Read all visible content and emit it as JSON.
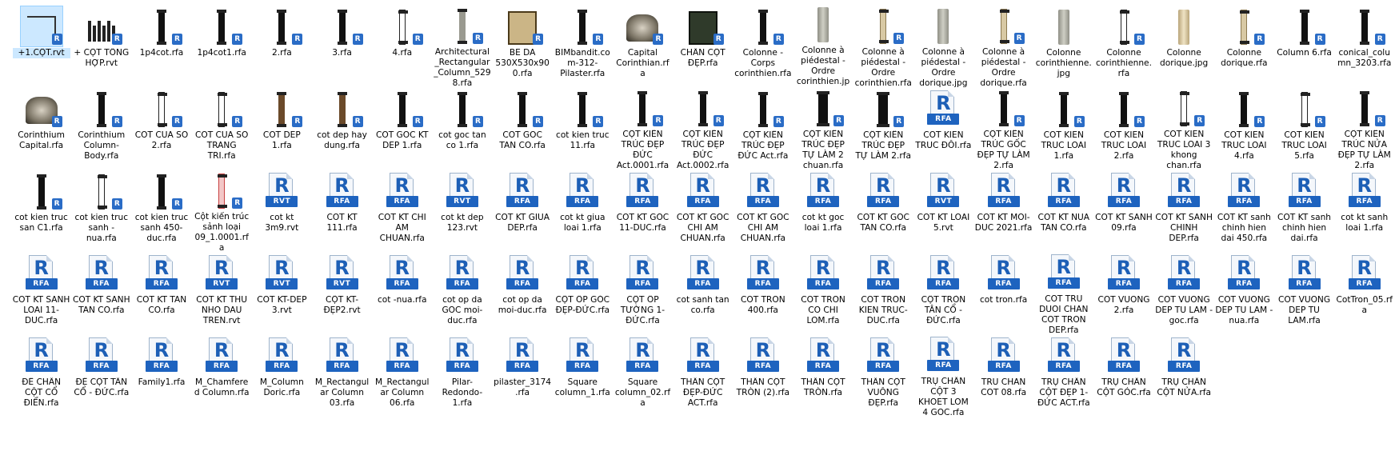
{
  "window": {
    "view": "large-icons"
  },
  "badge_letter": "R",
  "colors": {
    "accent": "#1e63bf",
    "selection": "#cce8ff"
  },
  "items": [
    {
      "name": "+1.CỘT.rvt",
      "type": "sketch",
      "selected": true
    },
    {
      "name": "+ CỘT TỔNG HỢP.rvt",
      "type": "multi"
    },
    {
      "name": "1p4cot.rfa",
      "type": "col"
    },
    {
      "name": "1p4cot1.rfa",
      "type": "col"
    },
    {
      "name": "2.rfa",
      "type": "col"
    },
    {
      "name": "3.rfa",
      "type": "col"
    },
    {
      "name": "4.rfa",
      "type": "col-white"
    },
    {
      "name": "Architectural_Rectangular_Column_5298.rfa",
      "type": "col-gray"
    },
    {
      "name": "BE DA 530X530x900.rfa",
      "type": "box"
    },
    {
      "name": "BIMbandit.com-312-Pilaster.rfa",
      "type": "col"
    },
    {
      "name": "Capital Corinthian.rfa",
      "type": "capital"
    },
    {
      "name": "CHÂN CỘT ĐẸP.rfa",
      "type": "box-dark"
    },
    {
      "name": "Colonne - Corps corinthien.rfa",
      "type": "col"
    },
    {
      "name": "Colonne à piédestal - Ordre corinthien.jpg",
      "type": "photo"
    },
    {
      "name": "Colonne à piédestal - Ordre corinthien.rfa",
      "type": "col-tan"
    },
    {
      "name": "Colonne à piédestal - Ordre dorique.jpg",
      "type": "photo"
    },
    {
      "name": "Colonne à piédestal - Ordre dorique.rfa",
      "type": "col-tan"
    },
    {
      "name": "Colonne corinthienne.jpg",
      "type": "photo"
    },
    {
      "name": "Colonne corinthienne.rfa",
      "type": "col-white"
    },
    {
      "name": "Colonne dorique.jpg",
      "type": "photo-tan"
    },
    {
      "name": "Colonne dorique.rfa",
      "type": "col-tan"
    },
    {
      "name": "Column 6.rfa",
      "type": "col"
    },
    {
      "name": "conical_column_3203.rfa",
      "type": "col"
    },
    {
      "name": "Corinthium Capital.rfa",
      "type": "capital"
    },
    {
      "name": "Corinthium Column-Body.rfa",
      "type": "col"
    },
    {
      "name": "COT CUA SO 2.rfa",
      "type": "col-white"
    },
    {
      "name": "COT CUA SO TRANG TRI.rfa",
      "type": "col-white"
    },
    {
      "name": "COT DEP 1.rfa",
      "type": "col-brown"
    },
    {
      "name": "cot dep hay dung.rfa",
      "type": "col-brown"
    },
    {
      "name": "COT GOC KT DEP 1.rfa",
      "type": "col"
    },
    {
      "name": "cot goc tan co 1.rfa",
      "type": "col"
    },
    {
      "name": "COT GOC TAN CO.rfa",
      "type": "col"
    },
    {
      "name": "cot kien truc 11.rfa",
      "type": "col"
    },
    {
      "name": "CỘT KIẾN TRÚC ĐẸP ĐỨC Act.0001.rfa",
      "type": "col"
    },
    {
      "name": "CỘT KIẾN TRÚC ĐẸP ĐỨC Act.0002.rfa",
      "type": "col"
    },
    {
      "name": "CỘT KIẾN TRÚC ĐẸP ĐỨC Act.rfa",
      "type": "col"
    },
    {
      "name": "CỘT KIẾN TRÚC ĐẸP TỰ LÀM 2 chuan.rfa",
      "type": "col-wide"
    },
    {
      "name": "CỘT KIẾN TRÚC ĐẸP TỰ LÀM 2.rfa",
      "type": "col-wide"
    },
    {
      "name": "COT KIEN TRUC ĐÔI.rfa",
      "type": "doc",
      "ext": "RFA"
    },
    {
      "name": "CỘT KIẾN TRÚC GỐC ĐẸP TỰ LÀM 2.rfa",
      "type": "col"
    },
    {
      "name": "COT KIEN TRUC LOAI 1.rfa",
      "type": "col"
    },
    {
      "name": "COT KIEN TRUC LOAI 2.rfa",
      "type": "col"
    },
    {
      "name": "COT KIEN TRUC LOAI 3 khong chan.rfa",
      "type": "col-white"
    },
    {
      "name": "COT KIEN TRUC LOAI 4.rfa",
      "type": "col"
    },
    {
      "name": "COT KIEN TRUC LOAI 5.rfa",
      "type": "col-white"
    },
    {
      "name": "CỘT KIẾN TRÚC NỬA ĐẸP TỰ LÀM 2.rfa",
      "type": "col"
    },
    {
      "name": "cot kien truc san C1.rfa",
      "type": "col"
    },
    {
      "name": "cot kien truc sanh - nua.rfa",
      "type": "col-white"
    },
    {
      "name": "cot kien truc sanh 450-duc.rfa",
      "type": "col"
    },
    {
      "name": "Cột kiến trúc sảnh loại 09_1.0001.rfa",
      "type": "col-red"
    },
    {
      "name": "cot kt 3m9.rvt",
      "type": "doc",
      "ext": "RVT"
    },
    {
      "name": "COT KT 111.rfa",
      "type": "doc",
      "ext": "RFA"
    },
    {
      "name": "COT KT CHI AM CHUAN.rfa",
      "type": "doc",
      "ext": "RFA"
    },
    {
      "name": "cot kt dep 123.rvt",
      "type": "doc",
      "ext": "RVT"
    },
    {
      "name": "COT KT GIUA DEP.rfa",
      "type": "doc",
      "ext": "RFA"
    },
    {
      "name": "cot kt giua loai 1.rfa",
      "type": "doc",
      "ext": "RFA"
    },
    {
      "name": "COT KT GOC 11-DUC.rfa",
      "type": "doc",
      "ext": "RFA"
    },
    {
      "name": "COT KT GOC CHI AM CHUAN.rfa",
      "type": "doc",
      "ext": "RFA"
    },
    {
      "name": "COT KT GOC CHI AM CHUAN.rfa",
      "type": "doc",
      "ext": "RFA"
    },
    {
      "name": "cot kt goc loai 1.rfa",
      "type": "doc",
      "ext": "RFA"
    },
    {
      "name": "COT KT GOC TAN CO.rfa",
      "type": "doc",
      "ext": "RFA"
    },
    {
      "name": "COT KT LOAI 5.rvt",
      "type": "doc",
      "ext": "RVT"
    },
    {
      "name": "COT KT MOI-DUC 2021.rfa",
      "type": "doc",
      "ext": "RFA"
    },
    {
      "name": "COT KT NUA TAN CO.rfa",
      "type": "doc",
      "ext": "RFA"
    },
    {
      "name": "COT KT SANH 09.rfa",
      "type": "doc",
      "ext": "RFA"
    },
    {
      "name": "COT KT SANH CHINH DEP.rfa",
      "type": "doc",
      "ext": "RFA"
    },
    {
      "name": "COT KT sanh chinh hien dai 450.rfa",
      "type": "doc",
      "ext": "RFA"
    },
    {
      "name": "COT KT sanh chinh hien dai.rfa",
      "type": "doc",
      "ext": "RFA"
    },
    {
      "name": "cot kt sanh loai 1.rfa",
      "type": "doc",
      "ext": "RFA"
    },
    {
      "name": "COT KT SANH LOAI 11-DUC.rfa",
      "type": "doc",
      "ext": "RFA"
    },
    {
      "name": "COT KT SANH TAN CO.rfa",
      "type": "doc",
      "ext": "RFA"
    },
    {
      "name": "COT KT TAN CO.rfa",
      "type": "doc",
      "ext": "RFA"
    },
    {
      "name": "COT KT THU NHO DAU TREN.rvt",
      "type": "doc",
      "ext": "RVT"
    },
    {
      "name": "COT KT-DEP 3.rvt",
      "type": "doc",
      "ext": "RVT"
    },
    {
      "name": "CỘT KT-ĐẸP2.rvt",
      "type": "doc",
      "ext": "RVT"
    },
    {
      "name": "cot -nua.rfa",
      "type": "doc",
      "ext": "RFA"
    },
    {
      "name": "cot op da GOC moi-duc.rfa",
      "type": "doc",
      "ext": "RFA"
    },
    {
      "name": "cot op da moi-duc.rfa",
      "type": "doc",
      "ext": "RFA"
    },
    {
      "name": "CỘT ỐP GÓC ĐẸP-ĐỨC.rfa",
      "type": "doc",
      "ext": "RFA"
    },
    {
      "name": "CỘT ỐP TƯỜNG 1-ĐỨC.rfa",
      "type": "doc",
      "ext": "RFA"
    },
    {
      "name": "cot sanh tan co.rfa",
      "type": "doc",
      "ext": "RFA"
    },
    {
      "name": "COT TRON 400.rfa",
      "type": "doc",
      "ext": "RFA"
    },
    {
      "name": "COT TRON CO CHI LOM.rfa",
      "type": "doc",
      "ext": "RFA"
    },
    {
      "name": "COT TRON KIEN TRUC-DUC.rfa",
      "type": "doc",
      "ext": "RFA"
    },
    {
      "name": "CỘT TRÒN TÂN CỔ - ĐỨC.rfa",
      "type": "doc",
      "ext": "RFA"
    },
    {
      "name": "cot tron.rfa",
      "type": "doc",
      "ext": "RFA"
    },
    {
      "name": "COT TRU DUOI CHAN COT TRON DEP.rfa",
      "type": "doc",
      "ext": "RFA"
    },
    {
      "name": "COT VUONG 2.rfa",
      "type": "doc",
      "ext": "RFA"
    },
    {
      "name": "COT VUONG DEP TU LAM - goc.rfa",
      "type": "doc",
      "ext": "RFA"
    },
    {
      "name": "COT VUONG DEP TU LAM - nua.rfa",
      "type": "doc",
      "ext": "RFA"
    },
    {
      "name": "COT VUONG DEP TU LAM.rfa",
      "type": "doc",
      "ext": "RFA"
    },
    {
      "name": "CotTron_05.rfa",
      "type": "doc",
      "ext": "RFA"
    },
    {
      "name": "ĐẾ CHÂN CỘT CỔ ĐIỂN.rfa",
      "type": "doc",
      "ext": "RFA"
    },
    {
      "name": "ĐẾ CỘT TÂN CỔ - ĐỨC.rfa",
      "type": "doc",
      "ext": "RFA"
    },
    {
      "name": "Family1.rfa",
      "type": "doc",
      "ext": "RFA"
    },
    {
      "name": "M_Chamfered Column.rfa",
      "type": "doc",
      "ext": "RFA"
    },
    {
      "name": "M_Column Doric.rfa",
      "type": "doc",
      "ext": "RFA"
    },
    {
      "name": "M_Rectangular Column 03.rfa",
      "type": "doc",
      "ext": "RFA"
    },
    {
      "name": "M_Rectangular Column 06.rfa",
      "type": "doc",
      "ext": "RFA"
    },
    {
      "name": "Pilar-Redondo-1.rfa",
      "type": "doc",
      "ext": "RFA"
    },
    {
      "name": "pilaster_3174.rfa",
      "type": "doc",
      "ext": "RFA"
    },
    {
      "name": "Square column_1.rfa",
      "type": "doc",
      "ext": "RFA"
    },
    {
      "name": "Square column_02.rfa",
      "type": "doc",
      "ext": "RFA"
    },
    {
      "name": "THÂN CỘT ĐẸP-ĐỨC ACT.rfa",
      "type": "doc",
      "ext": "RFA"
    },
    {
      "name": "THÂN CỘT TRÒN (2).rfa",
      "type": "doc",
      "ext": "RFA"
    },
    {
      "name": "THÂN CỘT TRÒN.rfa",
      "type": "doc",
      "ext": "RFA"
    },
    {
      "name": "THÂN CỘT VUÔNG ĐẸP.rfa",
      "type": "doc",
      "ext": "RFA"
    },
    {
      "name": "TRỤ CHÂN CỘT 3 KHOET LOM 4 GOC.rfa",
      "type": "doc",
      "ext": "RFA"
    },
    {
      "name": "TRU CHAN COT 08.rfa",
      "type": "doc",
      "ext": "RFA"
    },
    {
      "name": "TRỤ CHÂN CỘT ĐẸP 1-ĐỨC ACT.rfa",
      "type": "doc",
      "ext": "RFA"
    },
    {
      "name": "TRỤ CHÂN CỘT GÓC.rfa",
      "type": "doc",
      "ext": "RFA"
    },
    {
      "name": "TRỤ CHÂN CỘT NỬA.rfa",
      "type": "doc",
      "ext": "RFA"
    }
  ]
}
